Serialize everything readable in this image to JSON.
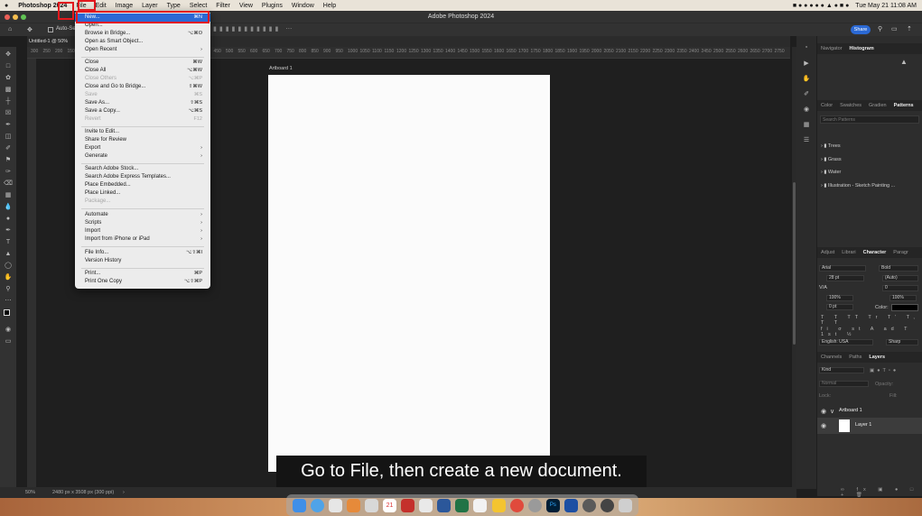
{
  "menubar": {
    "app_name": "Photoshop 2024",
    "items": [
      "File",
      "Edit",
      "Image",
      "Layer",
      "Type",
      "Select",
      "Filter",
      "View",
      "Plugins",
      "Window",
      "Help"
    ],
    "clock": "Tue May 21  11:08 AM"
  },
  "window": {
    "title": "Adobe Photoshop 2024"
  },
  "options": {
    "auto_select": "Auto-Se",
    "share_label": "Share"
  },
  "document": {
    "tab_title": "Untitled-1 @ 50%",
    "artboard_label": "Artboard 1",
    "zoom": "50%",
    "doc_info": "2480 px x 3508 px (300 ppi)",
    "ruler_ticks": [
      "300",
      "250",
      "200",
      "150",
      "100",
      "50",
      "0",
      "50",
      "100",
      "150",
      "200",
      "250",
      "300",
      "350",
      "400",
      "450",
      "500",
      "550",
      "600",
      "650",
      "700",
      "750",
      "800",
      "850",
      "900",
      "950",
      "1000",
      "1050",
      "1100",
      "1150",
      "1200",
      "1250",
      "1300",
      "1350",
      "1400",
      "1450",
      "1500",
      "1550",
      "1600",
      "1650",
      "1700",
      "1750",
      "1800",
      "1850",
      "1900",
      "1950",
      "2000",
      "2050",
      "2100",
      "2150",
      "2200",
      "2250",
      "2300",
      "2350",
      "2400",
      "2450",
      "2500",
      "2550",
      "2600",
      "2650",
      "2700",
      "2750"
    ]
  },
  "file_menu": {
    "items": [
      {
        "label": "New...",
        "shortcut": "⌘N"
      },
      {
        "label": "Open...",
        "shortcut": ""
      },
      {
        "label": "Browse in Bridge...",
        "shortcut": "⌥⌘O"
      },
      {
        "label": "Open as Smart Object...",
        "shortcut": ""
      },
      {
        "label": "Open Recent",
        "shortcut": "›"
      },
      {
        "label": "Close",
        "shortcut": "⌘W"
      },
      {
        "label": "Close All",
        "shortcut": "⌥⌘W"
      },
      {
        "label": "Close Others",
        "shortcut": "⌥⌘P"
      },
      {
        "label": "Close and Go to Bridge...",
        "shortcut": "⇧⌘W"
      },
      {
        "label": "Save",
        "shortcut": "⌘S"
      },
      {
        "label": "Save As...",
        "shortcut": "⇧⌘S"
      },
      {
        "label": "Save a Copy...",
        "shortcut": "⌥⌘S"
      },
      {
        "label": "Revert",
        "shortcut": "F12"
      },
      {
        "label": "Invite to Edit...",
        "shortcut": ""
      },
      {
        "label": "Share for Review",
        "shortcut": ""
      },
      {
        "label": "Export",
        "shortcut": "›"
      },
      {
        "label": "Generate",
        "shortcut": "›"
      },
      {
        "label": "Search Adobe Stock...",
        "shortcut": ""
      },
      {
        "label": "Search Adobe Express Templates...",
        "shortcut": ""
      },
      {
        "label": "Place Embedded...",
        "shortcut": ""
      },
      {
        "label": "Place Linked...",
        "shortcut": ""
      },
      {
        "label": "Package...",
        "shortcut": ""
      },
      {
        "label": "Automate",
        "shortcut": "›"
      },
      {
        "label": "Scripts",
        "shortcut": "›"
      },
      {
        "label": "Import",
        "shortcut": "›"
      },
      {
        "label": "Import from iPhone or iPad",
        "shortcut": "›"
      },
      {
        "label": "File Info...",
        "shortcut": "⌥⇧⌘I"
      },
      {
        "label": "Version History",
        "shortcut": ""
      },
      {
        "label": "Print...",
        "shortcut": "⌘P"
      },
      {
        "label": "Print One Copy",
        "shortcut": "⌥⇧⌘P"
      }
    ]
  },
  "panels": {
    "top_tabs": [
      "Navigator",
      "Histogram"
    ],
    "pattern_tabs": [
      "Color",
      "Swatches",
      "Gradien",
      "Patterns"
    ],
    "pattern_search_placeholder": "Search Patterns",
    "pattern_groups": [
      "Trees",
      "Grass",
      "Water",
      "Illustration - Sketch Painting ..."
    ],
    "char_tabs": [
      "Adjust",
      "Librari",
      "Character",
      "Paragr"
    ],
    "font_family": "Arial",
    "font_style": "Bold",
    "font_size": "28 pt",
    "leading": "(Auto)",
    "kerning": "V/A",
    "tracking": "0",
    "vscale": "100%",
    "hscale": "100%",
    "baseline": "0 pt",
    "color_label": "Color:",
    "language": "English: USA",
    "antialias": "Sharp",
    "layers_tabs": [
      "Channels",
      "Paths",
      "Layers"
    ],
    "layer_filter": "Kind",
    "blend_mode": "Normal",
    "opacity_label": "Opacity:",
    "lock_label": "Lock:",
    "fill_label": "Fill:",
    "layers": [
      "Artboard 1",
      "Layer 1"
    ]
  },
  "caption": "Go to File, then create a new document."
}
